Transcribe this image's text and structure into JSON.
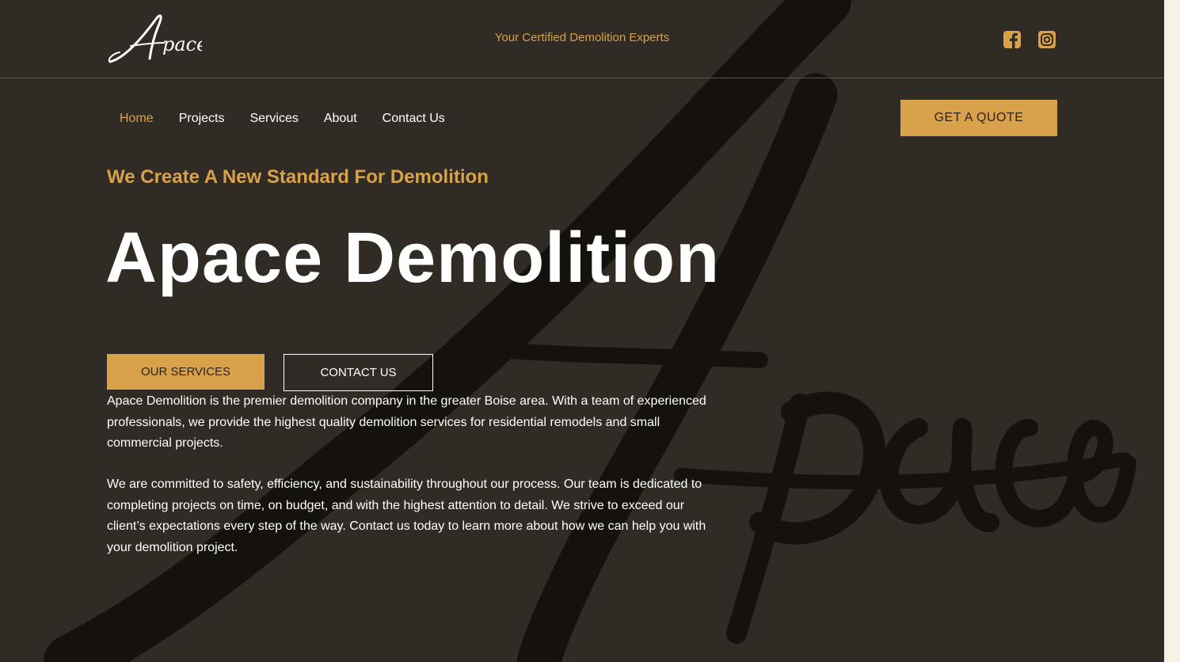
{
  "colors": {
    "background": "#302b24",
    "accent": "#d9a24a",
    "text": "#ffffff",
    "side_strip": "#f6f2e4"
  },
  "header": {
    "logo_text": "Apace",
    "tagline": "Your Certified Demolition Experts",
    "social": [
      {
        "icon": "facebook-icon"
      },
      {
        "icon": "instagram-icon"
      }
    ]
  },
  "nav": {
    "items": [
      {
        "label": "Home",
        "active": true
      },
      {
        "label": "Projects",
        "active": false
      },
      {
        "label": "Services",
        "active": false
      },
      {
        "label": "About",
        "active": false
      },
      {
        "label": "Contact Us",
        "active": false
      }
    ],
    "cta_label": "GET A QUOTE"
  },
  "hero": {
    "eyebrow": "We Create A New Standard For Demolition",
    "title": "Apace Demolition",
    "primary_button": "OUR SERVICES",
    "secondary_button": "CONTACT US",
    "paragraphs": [
      "Apace Demolition is the premier demolition company in the greater Boise area. With a team of experienced professionals, we provide the highest quality demolition services for residential remodels and small commercial projects.",
      "We are committed to safety, efficiency, and sustainability throughout our process. Our team is dedicated to completing projects on time, on budget, and with the highest attention to detail. We strive to exceed our client’s expectations every step of the way. Contact us today to learn more about how we can help you with your demolition project."
    ]
  },
  "watermark": {
    "icon": "apace-script-watermark"
  }
}
